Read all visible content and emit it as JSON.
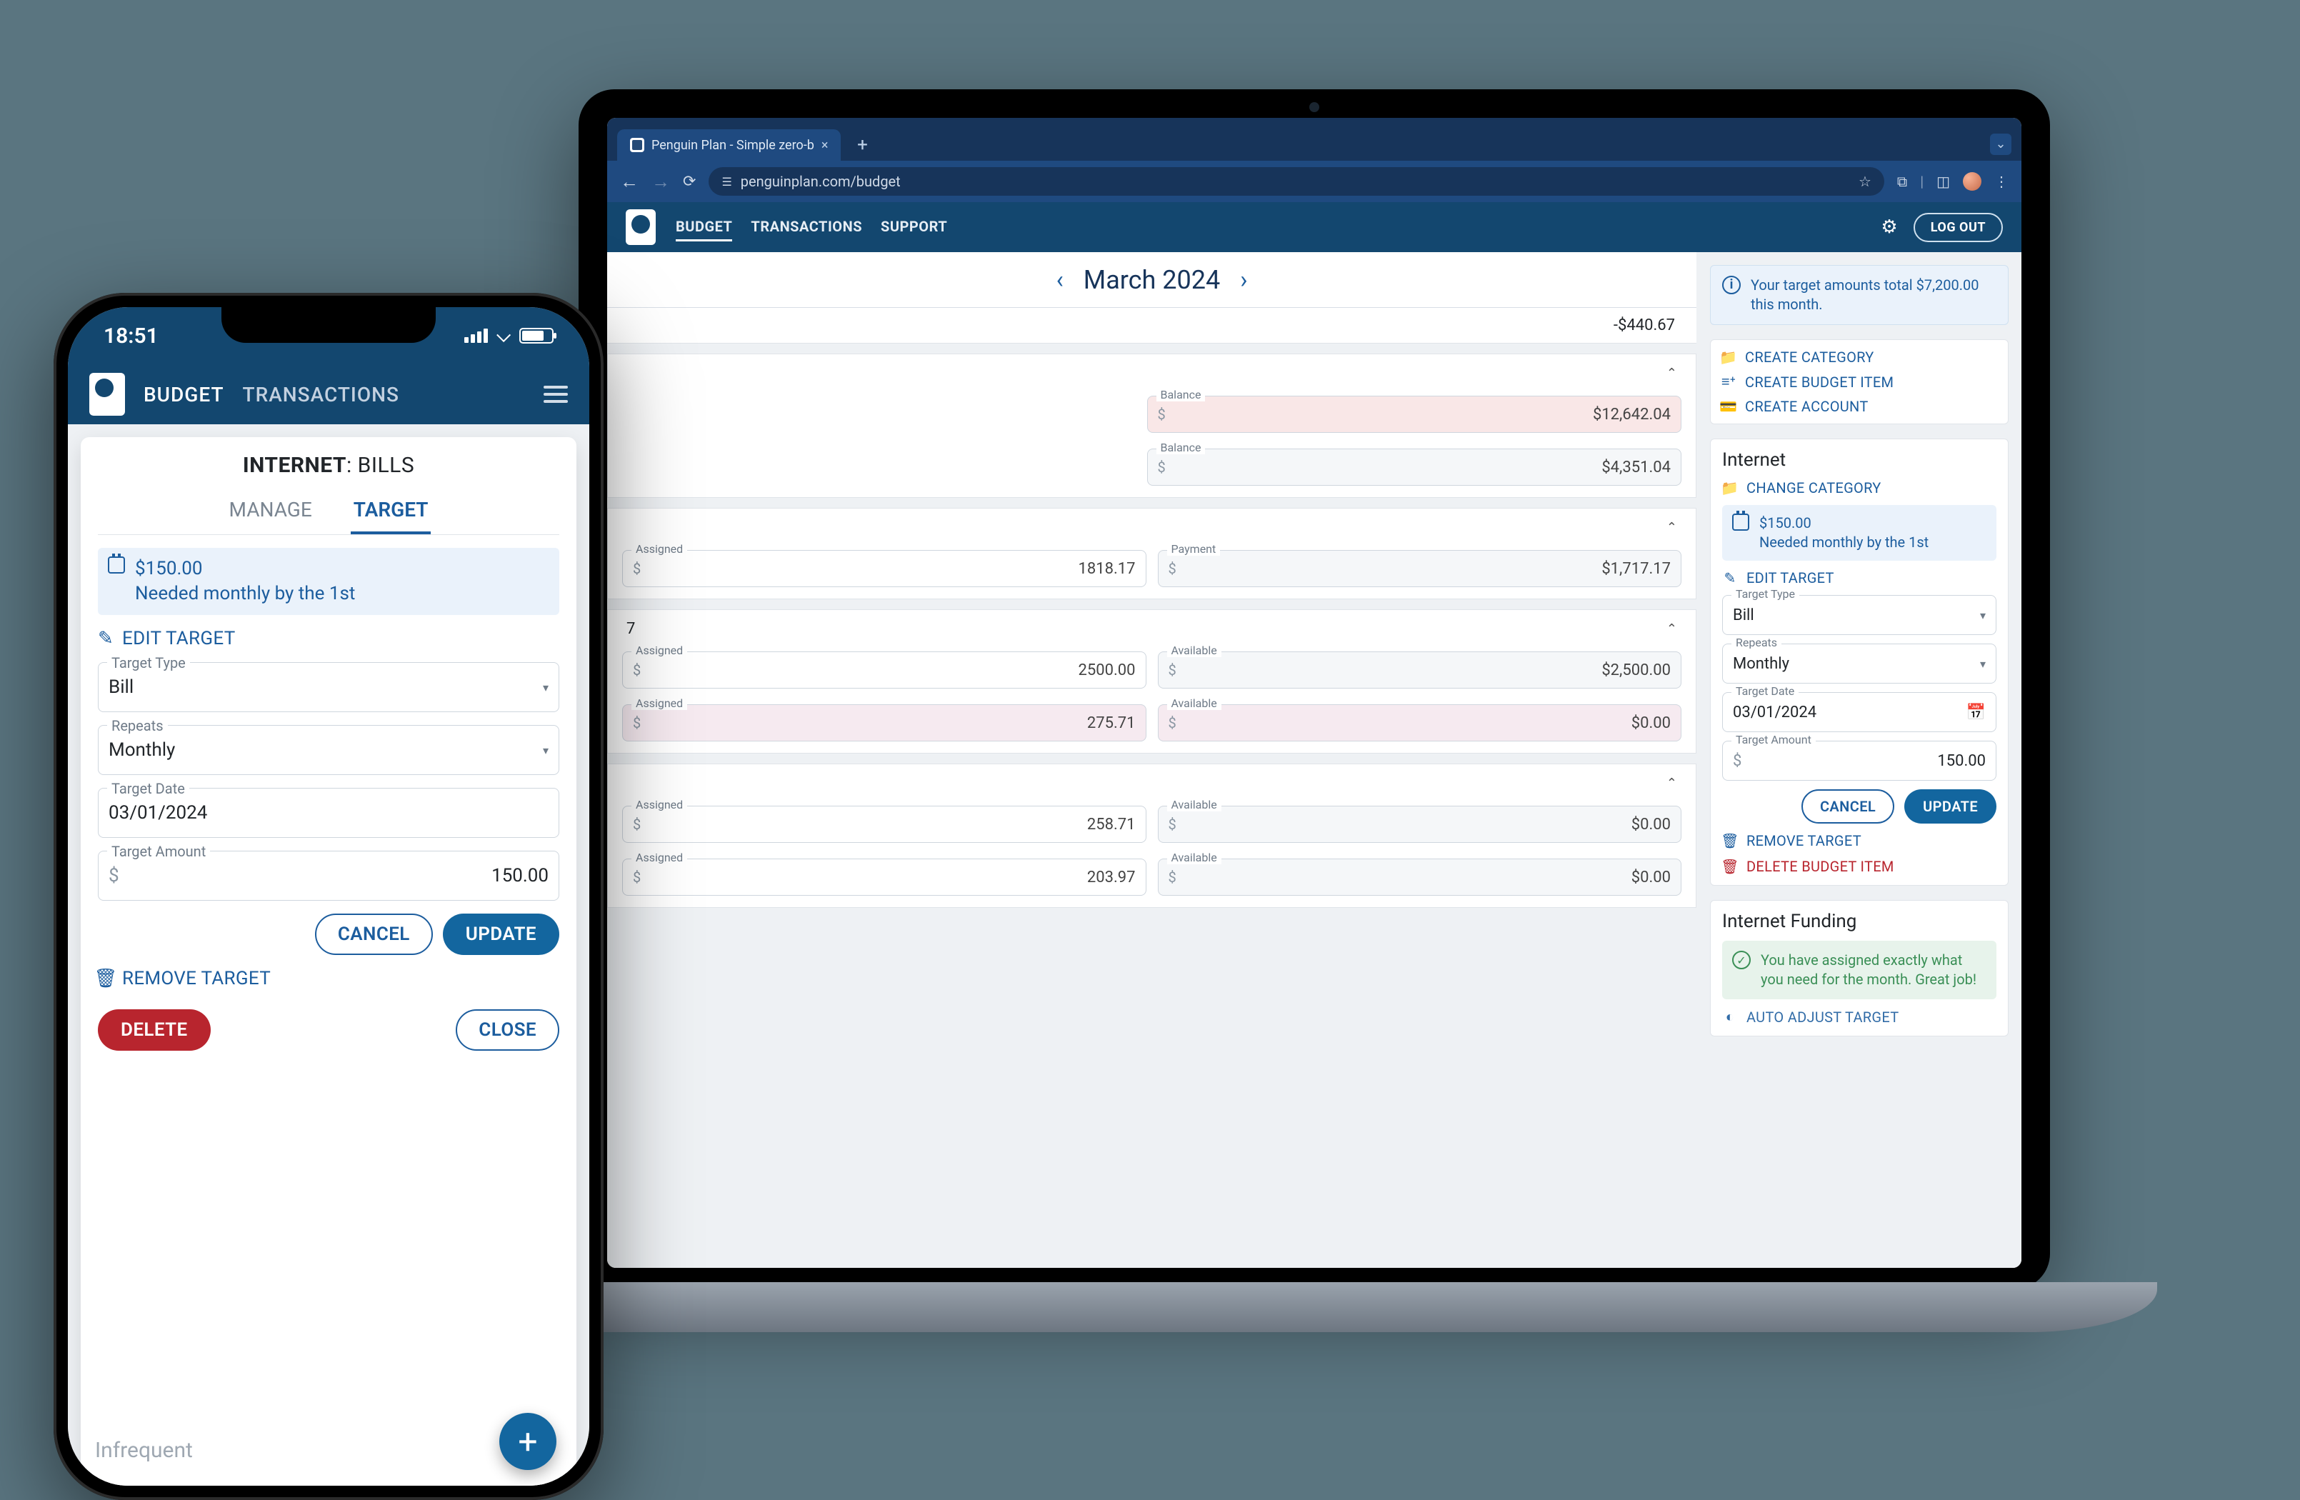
{
  "browser": {
    "tab_title": "Penguin Plan - Simple zero-b",
    "url": "penguinplan.com/budget"
  },
  "app": {
    "nav": {
      "budget": "BUDGET",
      "transactions": "TRANSACTIONS",
      "support": "SUPPORT"
    },
    "logout": "LOG OUT"
  },
  "month": {
    "label": "March 2024"
  },
  "balance_neg": "-$440.67",
  "cat1": {
    "rows": [
      {
        "balance_label": "Balance",
        "value": "$12,642.04"
      },
      {
        "balance_label": "Balance",
        "value": "$4,351.04"
      }
    ]
  },
  "cat2": {
    "assigned_label": "Assigned",
    "payment_label": "Payment",
    "assigned_val": "1818.17",
    "payment_val": "$1,717.17"
  },
  "cat3": {
    "rows": [
      {
        "assigned": "2500.00",
        "available": "$2,500.00"
      },
      {
        "assigned": "275.71",
        "available": "$0.00"
      }
    ],
    "labels": {
      "assigned": "Assigned",
      "available": "Available"
    }
  },
  "cat4": {
    "rows": [
      {
        "assigned": "258.71",
        "available": "$0.00"
      },
      {
        "assigned": "203.97",
        "available": "$0.00"
      }
    ],
    "labels": {
      "assigned": "Assigned",
      "available": "Available"
    }
  },
  "side": {
    "info": "Your target amounts total $7,200.00 this month.",
    "actions": {
      "create_category": "CREATE CATEGORY",
      "create_item": "CREATE BUDGET ITEM",
      "create_account": "CREATE ACCOUNT"
    },
    "item": {
      "title": "Internet",
      "change_category": "CHANGE CATEGORY",
      "target_amount": "$150.00",
      "target_line": "Needed monthly by the 1st",
      "edit_target": "EDIT TARGET",
      "fields": {
        "type_label": "Target Type",
        "type_val": "Bill",
        "repeats_label": "Repeats",
        "repeats_val": "Monthly",
        "date_label": "Target Date",
        "date_val": "03/01/2024",
        "amount_label": "Target Amount",
        "amount_val": "150.00"
      },
      "cancel": "CANCEL",
      "update": "UPDATE",
      "remove_target": "REMOVE TARGET",
      "delete_item": "DELETE BUDGET ITEM"
    },
    "funding": {
      "title": "Internet Funding",
      "msg": "You have assigned exactly what you need for the month. Great job!",
      "auto": "AUTO ADJUST TARGET"
    }
  },
  "mobile": {
    "time": "18:51",
    "nav": {
      "budget": "BUDGET",
      "transactions": "TRANSACTIONS"
    },
    "sheet": {
      "title_a": "INTERNET",
      "title_b": ": BILLS",
      "tab_manage": "MANAGE",
      "tab_target": "TARGET",
      "target_amount": "$150.00",
      "target_line": "Needed monthly by the 1st",
      "edit_target": "EDIT TARGET",
      "type_label": "Target Type",
      "type_val": "Bill",
      "repeats_label": "Repeats",
      "repeats_val": "Monthly",
      "date_label": "Target Date",
      "date_val": "03/01/2024",
      "amount_label": "Target Amount",
      "amount_val": "150.00",
      "cancel": "CANCEL",
      "update": "UPDATE",
      "remove_target": "REMOVE TARGET",
      "delete": "DELETE",
      "close": "CLOSE"
    },
    "back_word": "Infrequent"
  },
  "labels": {
    "dollar": "$"
  },
  "partial": {
    "seven": "7"
  }
}
